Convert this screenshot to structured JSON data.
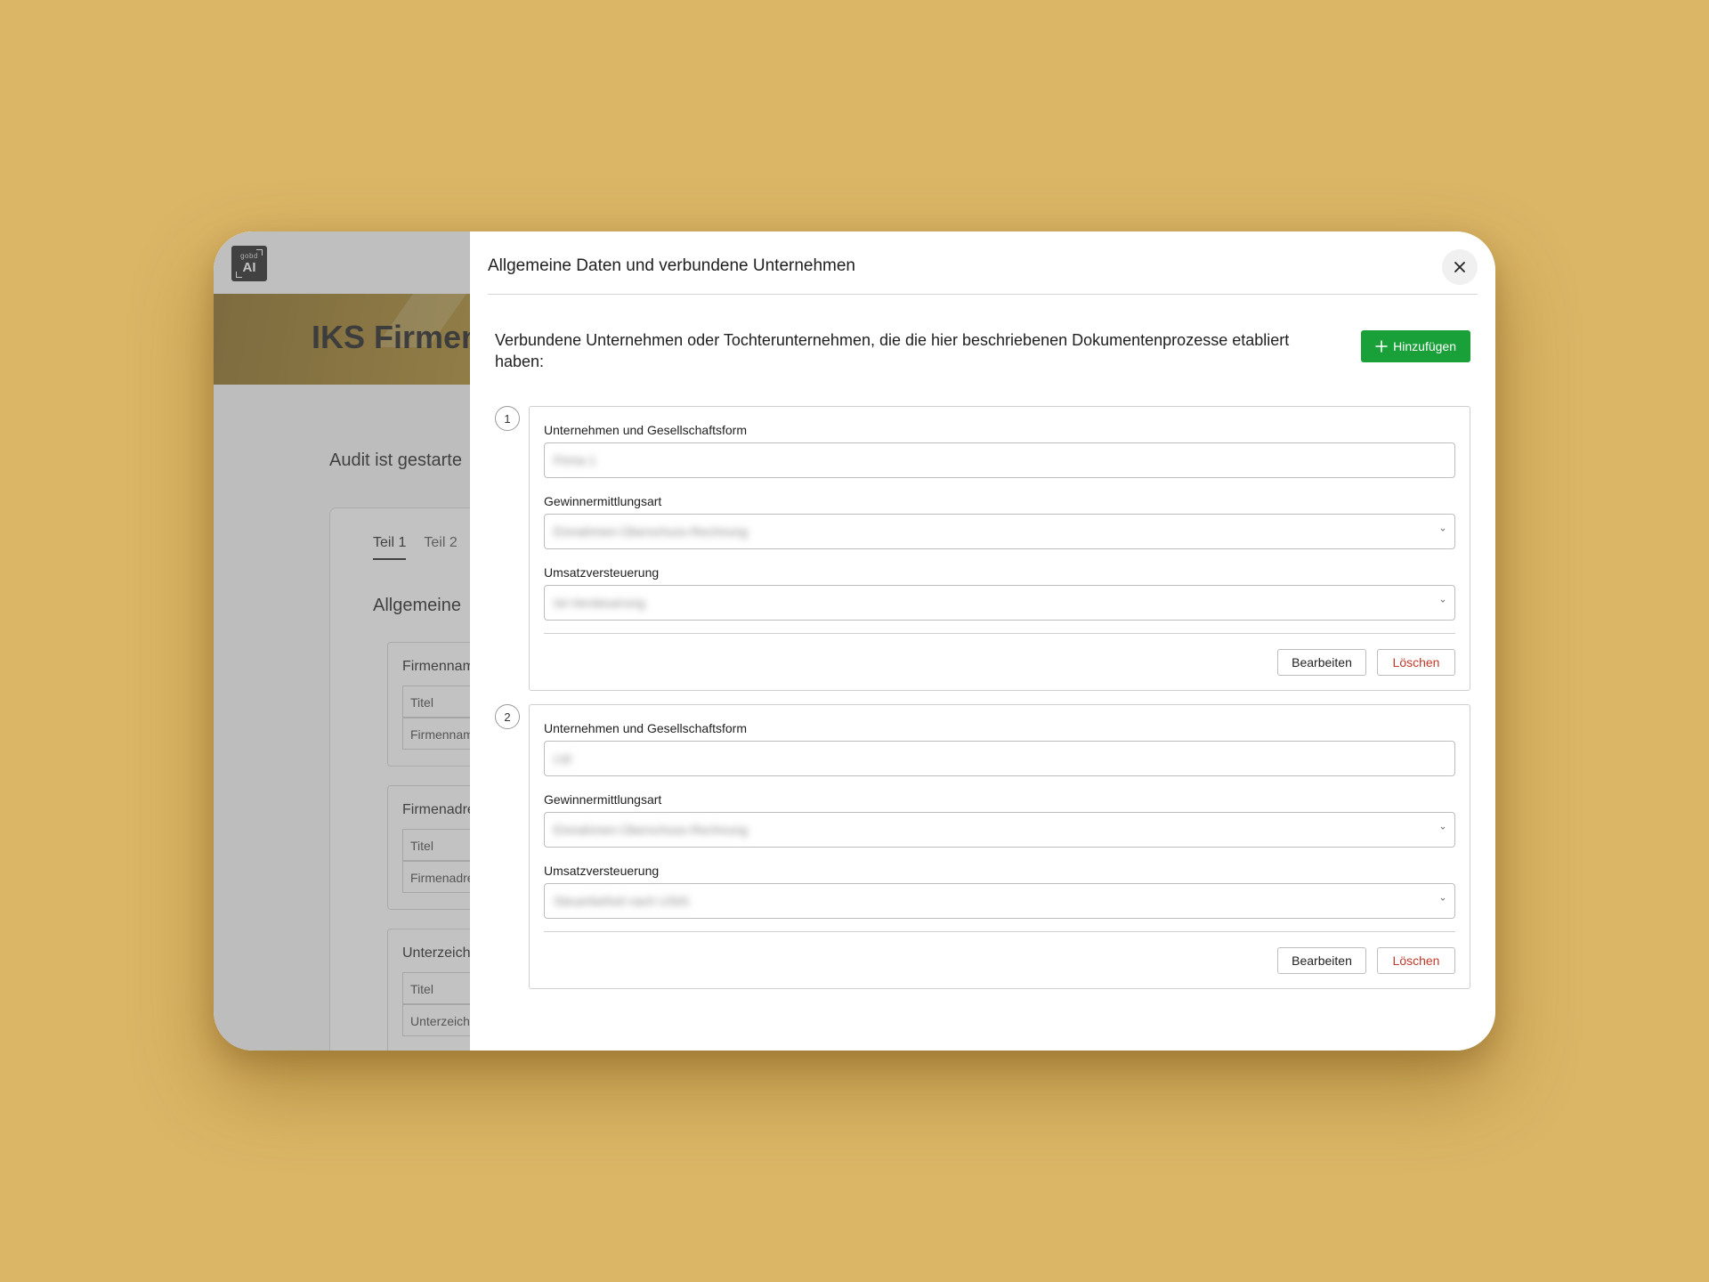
{
  "app": {
    "logo_top": "gobd",
    "logo_bottom": "AI",
    "hero_title": "IKS Firmen",
    "audit_status": "Audit ist gestarte",
    "tabs": [
      {
        "label": "Teil 1"
      },
      {
        "label": "Teil 2"
      }
    ],
    "section_title": "Allgemeine",
    "cards": [
      {
        "title": "Firmenname",
        "row1": "Titel",
        "row2": "Firmenname"
      },
      {
        "title": "Firmenadres",
        "row1": "Titel",
        "row2": "Firmenadres"
      },
      {
        "title": "Unterzeichn",
        "row1": "Titel",
        "row2": "Unterzeichne"
      }
    ]
  },
  "modal": {
    "title": "Allgemeine Daten und verbundene Unternehmen",
    "intro": "Verbundene Unternehmen oder Tochterunternehmen, die die hier beschriebenen Dokumentenprozesse etabliert haben:",
    "add_label": "Hinzufügen",
    "entries": [
      {
        "number": "1",
        "company_label": "Unternehmen und Gesellschaftsform",
        "company_value": "Firma 1",
        "profit_label": "Gewinnermittlungsart",
        "profit_value": "Einnahmen-Überschuss-Rechnung",
        "vat_label": "Umsatzversteuerung",
        "vat_value": "Ist-Versteuerung",
        "edit_label": "Bearbeiten",
        "delete_label": "Löschen"
      },
      {
        "number": "2",
        "company_label": "Unternehmen und Gesellschaftsform",
        "company_value": "Ltd",
        "profit_label": "Gewinnermittlungsart",
        "profit_value": "Einnahmen-Überschuss-Rechnung",
        "vat_label": "Umsatzversteuerung",
        "vat_value": "Steuerbefreit nach UStG",
        "edit_label": "Bearbeiten",
        "delete_label": "Löschen"
      }
    ]
  },
  "colors": {
    "background": "#dbb667",
    "primary_green": "#1aa039",
    "delete_red": "#c0392b",
    "hero_gold": "#b8952f"
  }
}
